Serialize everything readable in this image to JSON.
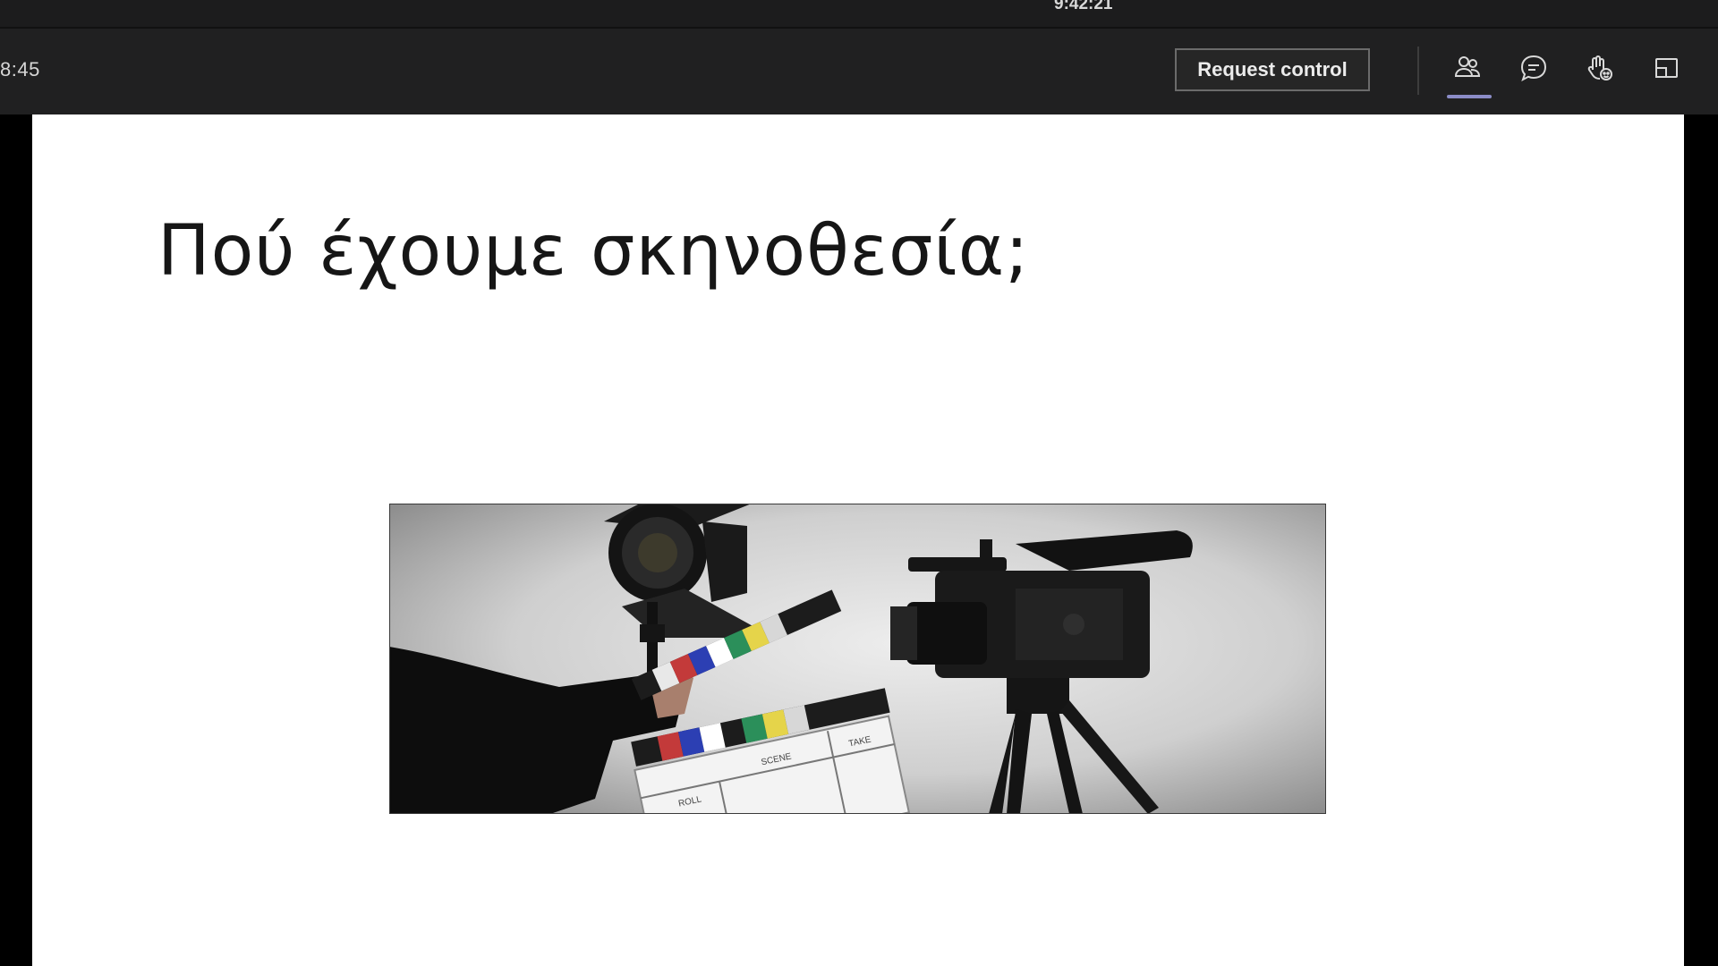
{
  "window": {
    "clock": "9:42:21"
  },
  "toolbar": {
    "meeting_timer": "8:45",
    "request_control_label": "Request control",
    "icons": [
      "people-icon",
      "chat-icon",
      "reactions-icon",
      "view-icon"
    ],
    "active_icon": "people-icon",
    "accent_color": "#8b8cc7"
  },
  "slide": {
    "title": "Πού έχουμε σκηνοθεσία;",
    "image": {
      "description_icons": [
        "film-light-icon",
        "clapperboard-icon",
        "video-camera-icon"
      ],
      "clapper_labels": {
        "roll": "ROLL",
        "scene": "SCENE",
        "take": "TAKE"
      }
    }
  }
}
